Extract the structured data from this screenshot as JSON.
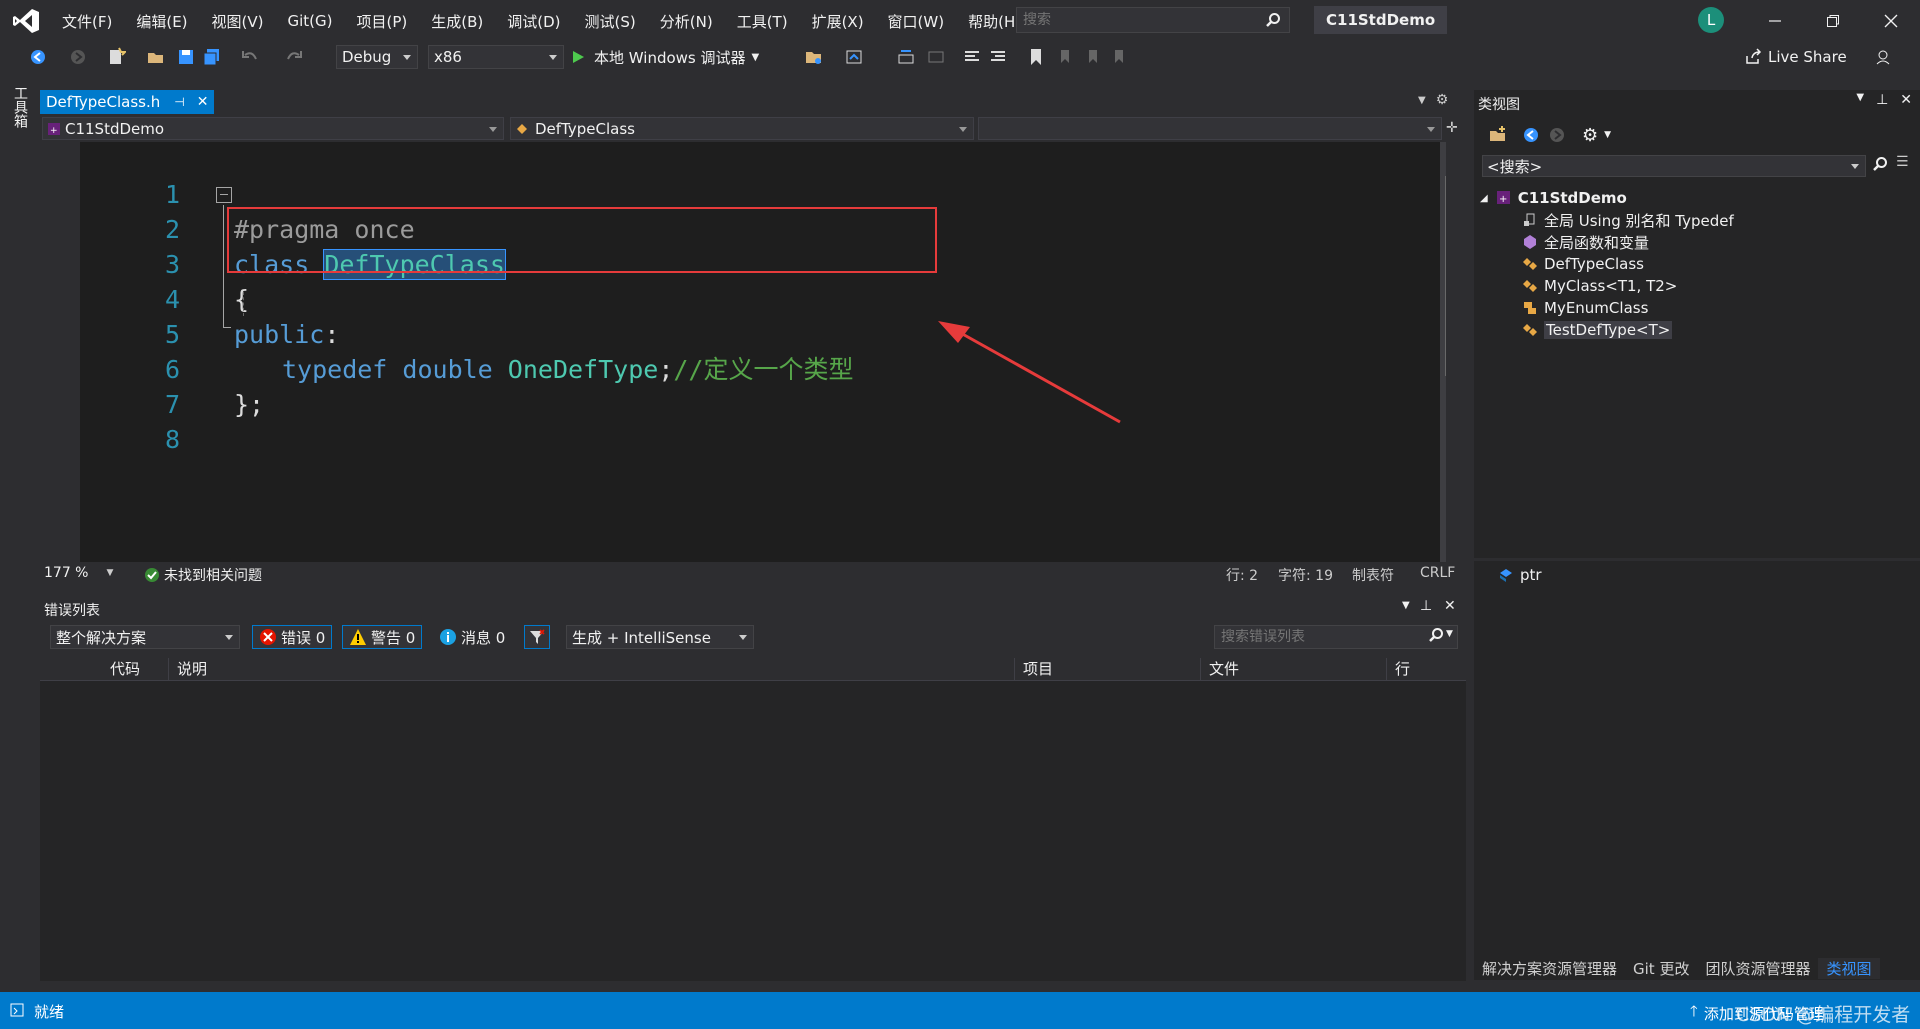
{
  "menu": [
    "文件(F)",
    "编辑(E)",
    "视图(V)",
    "Git(G)",
    "项目(P)",
    "生成(B)",
    "调试(D)",
    "测试(S)",
    "分析(N)",
    "工具(T)",
    "扩展(X)",
    "窗口(W)",
    "帮助(H)"
  ],
  "search": {
    "placeholder": "搜索"
  },
  "solution_name": "C11StdDemo",
  "user_initial": "L",
  "toolbar": {
    "config": "Debug",
    "platform": "x86",
    "run_label": "本地 Windows 调试器",
    "liveshare": "Live Share"
  },
  "left_strip": {
    "toolbox": "工具箱"
  },
  "editor": {
    "tab_name": "DefTypeClass.h",
    "nav_project": "C11StdDemo",
    "nav_class": "DefTypeClass",
    "lines": [
      {
        "n": "1"
      },
      {
        "n": "2"
      },
      {
        "n": "3"
      },
      {
        "n": "4"
      },
      {
        "n": "5"
      },
      {
        "n": "6"
      },
      {
        "n": "7"
      },
      {
        "n": "8"
      }
    ],
    "code": {
      "l1": "#pragma once",
      "l2_kw": "class",
      "l2_name": "DefTypeClass",
      "l3": "{",
      "l4_kw": "public",
      "l4_colon": ":",
      "l5_kw1": "typedef",
      "l5_kw2": "double",
      "l5_type": "OneDefType",
      "l5_semi": ";",
      "l5_comment": "//定义一个类型",
      "l6": "};"
    },
    "status": {
      "zoom": "177 %",
      "issues": "未找到相关问题",
      "line": "行: 2",
      "col": "字符: 19",
      "tabs": "制表符",
      "eol": "CRLF"
    }
  },
  "error_list": {
    "title": "错误列表",
    "scope": "整个解决方案",
    "errors": "错误 0",
    "warnings": "警告 0",
    "messages": "消息 0",
    "build_filter": "生成 + IntelliSense",
    "search_placeholder": "搜索错误列表",
    "columns": {
      "code": "代码",
      "desc": "说明",
      "project": "项目",
      "file": "文件",
      "line": "行"
    }
  },
  "class_view": {
    "title": "类视图",
    "search": "<搜索>",
    "tree": {
      "root": "C11StdDemo",
      "items": [
        "全局 Using 别名和 Typedef",
        "全局函数和变量",
        "DefTypeClass",
        "MyClass<T1, T2>",
        "MyEnumClass",
        "TestDefType<T>"
      ]
    },
    "member": "ptr",
    "bottom_tabs": [
      "解决方案资源管理器",
      "Git 更改",
      "团队资源管理器",
      "类视图"
    ]
  },
  "statusbar": {
    "ready": "就绪",
    "source_control": "添加到源代码管理",
    "watermark": "CSDN @编程开发者"
  },
  "colors": {
    "accent": "#007acc",
    "keyword": "#569cd6",
    "type": "#4ec9b0",
    "comment": "#57a64a",
    "annotation_red": "#e63b3b"
  }
}
